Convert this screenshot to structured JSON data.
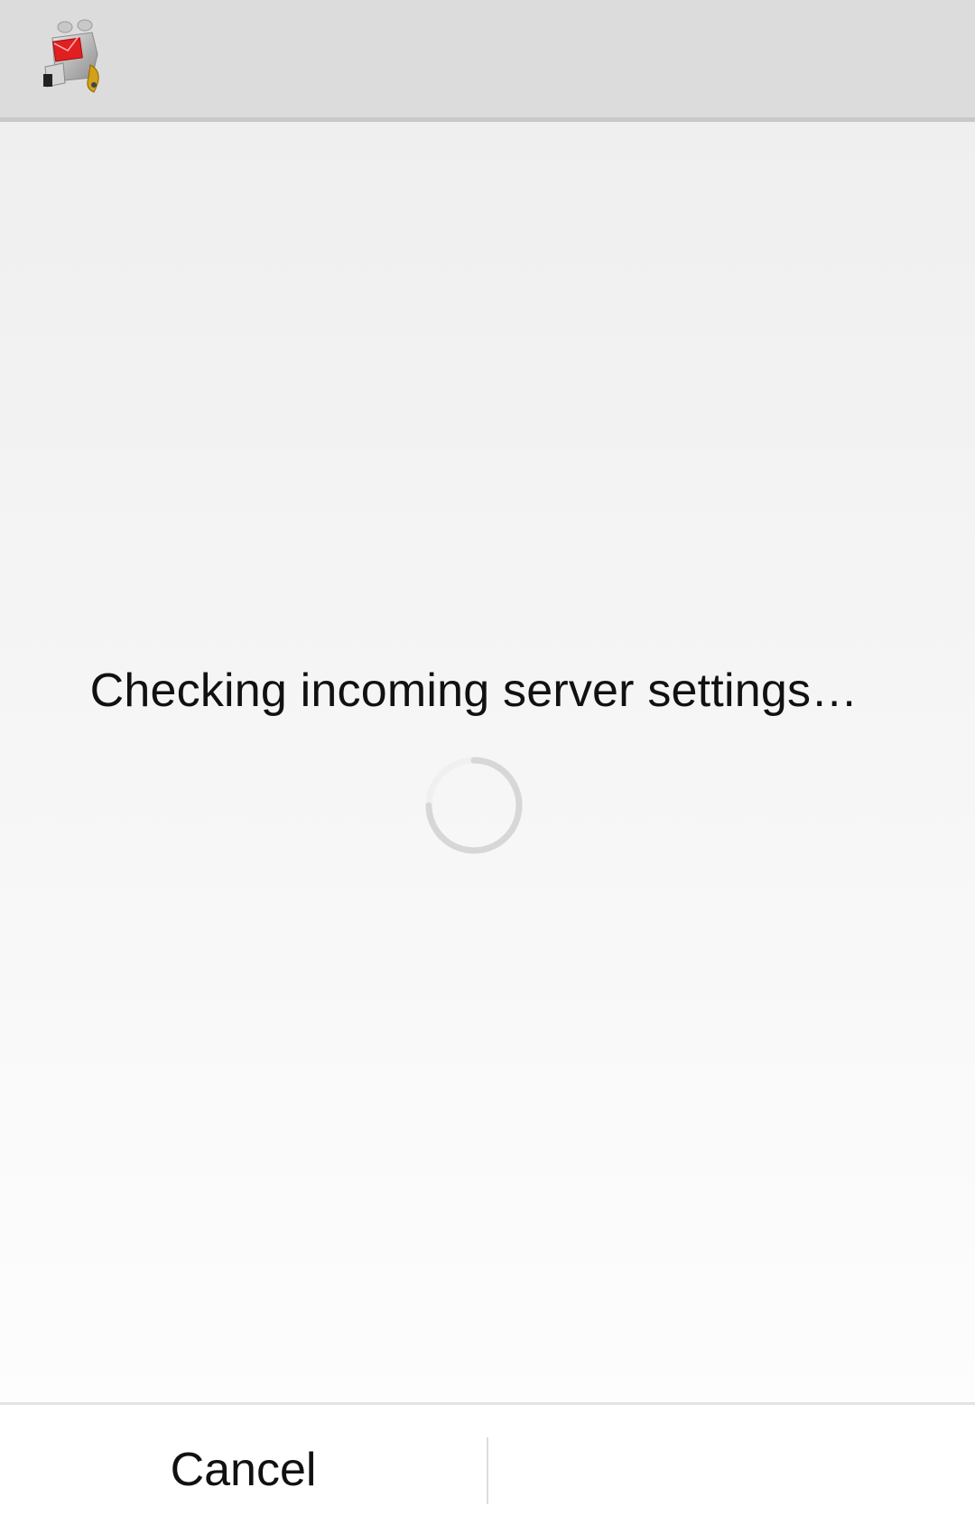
{
  "action_bar": {
    "logo_icon": "mail-robot-icon",
    "colors": {
      "background": "#dcdcdc",
      "envelope": "#e02020"
    }
  },
  "status": {
    "message": "Checking incoming server settings…",
    "spinner_icon": "loading-spinner-icon"
  },
  "buttons": {
    "cancel_label": "Cancel"
  }
}
